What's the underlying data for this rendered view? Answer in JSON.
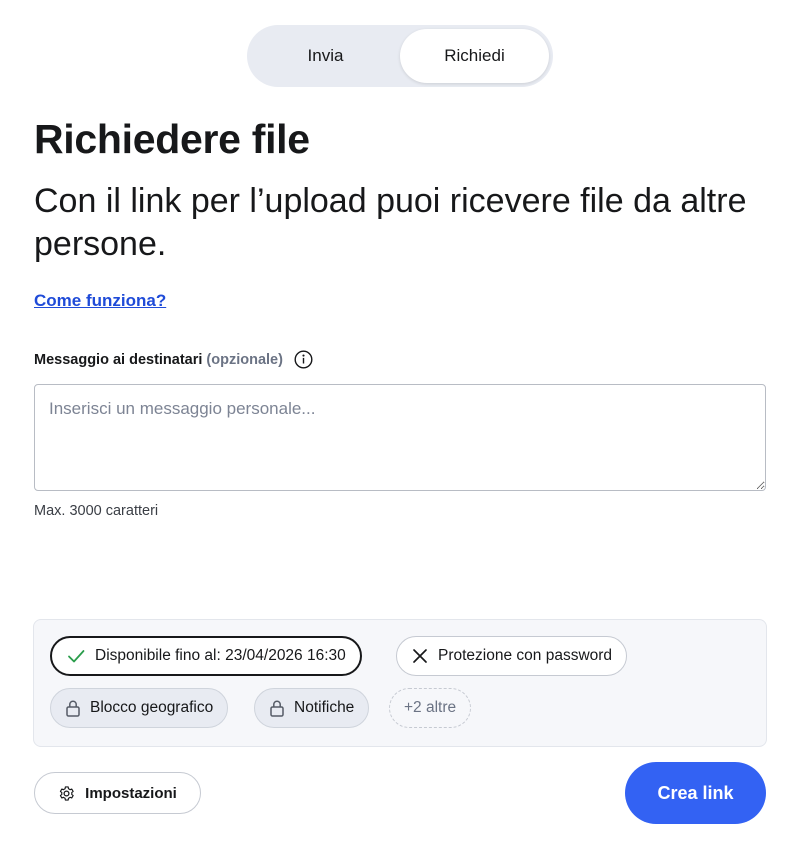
{
  "mode_toggle": {
    "options": [
      {
        "label": "Invia",
        "active": false
      },
      {
        "label": "Richiedi",
        "active": true
      }
    ]
  },
  "header": {
    "title": "Richiedere file",
    "subtitle": "Con il link per l’upload puoi ricevere file da altre persone."
  },
  "help_link": "Come funziona?",
  "message_field": {
    "label": "Messaggio ai destinatari",
    "optional_label": "(opzionale)",
    "placeholder": "Inserisci un messaggio personale...",
    "value": "",
    "hint": "Max. 3000 caratteri"
  },
  "options": {
    "expiry": {
      "label": "Disponibile fino al: 23/04/2026 16:30",
      "state": "enabled",
      "icon": "check-icon"
    },
    "password": {
      "label": "Protezione con password",
      "state": "disabled",
      "icon": "close-icon"
    },
    "geo_block": {
      "label": "Blocco geografico",
      "state": "locked",
      "icon": "lock-icon"
    },
    "notifications": {
      "label": "Notifiche",
      "state": "locked",
      "icon": "lock-icon"
    },
    "more": {
      "label": "+2 altre"
    }
  },
  "footer": {
    "settings_label": "Impostazioni",
    "create_label": "Crea link"
  },
  "colors": {
    "primary": "#3362f3",
    "link": "#1f4bd8",
    "check": "#2a9d4b"
  }
}
